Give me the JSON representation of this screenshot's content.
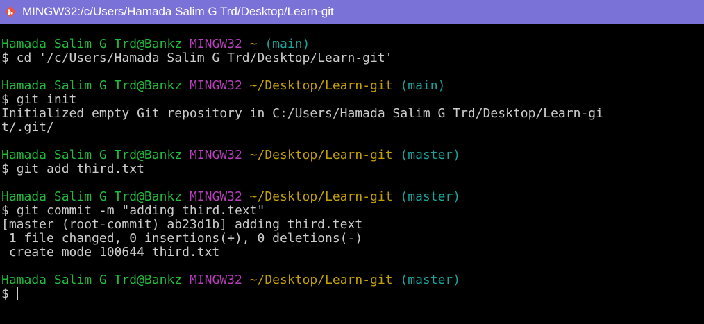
{
  "window": {
    "title": "MINGW32:/c/Users/Hamada Salim G Trd/Desktop/Learn-git",
    "icon": "git-bash-icon"
  },
  "colors": {
    "titlebar": "#7a72d6",
    "background": "#000000",
    "text": "#cccccc",
    "user": "#1fbc3c",
    "system": "#b93ebd",
    "path": "#c2a000",
    "branch": "#1ba39c"
  },
  "blocks": [
    {
      "prompt": {
        "user": "Hamada Salim G Trd@Bankz",
        "system": "MINGW32",
        "path": "~",
        "branch": "(main)"
      },
      "command": "$ cd '/c/Users/Hamada Salim G Trd/Desktop/Learn-git'",
      "output": []
    },
    {
      "prompt": {
        "user": "Hamada Salim G Trd@Bankz",
        "system": "MINGW32",
        "path": "~/Desktop/Learn-git",
        "branch": "(main)"
      },
      "command": "$ git init",
      "output": [
        "Initialized empty Git repository in C:/Users/Hamada Salim G Trd/Desktop/Learn-gi",
        "t/.git/"
      ]
    },
    {
      "prompt": {
        "user": "Hamada Salim G Trd@Bankz",
        "system": "MINGW32",
        "path": "~/Desktop/Learn-git",
        "branch": "(master)"
      },
      "command": "$ git add third.txt",
      "output": []
    },
    {
      "prompt": {
        "user": "Hamada Salim G Trd@Bankz",
        "system": "MINGW32",
        "path": "~/Desktop/Learn-git",
        "branch": "(master)"
      },
      "command_prefix": "$ ",
      "command_rest": "git commit -m \"adding third.text\"",
      "output": [
        "[master (root-commit) ab23d1b] adding third.text",
        " 1 file changed, 0 insertions(+), 0 deletions(-)",
        " create mode 100644 third.txt"
      ]
    },
    {
      "prompt": {
        "user": "Hamada Salim G Trd@Bankz",
        "system": "MINGW32",
        "path": "~/Desktop/Learn-git",
        "branch": "(master)"
      },
      "command_prefix": "$ ",
      "output": []
    }
  ]
}
